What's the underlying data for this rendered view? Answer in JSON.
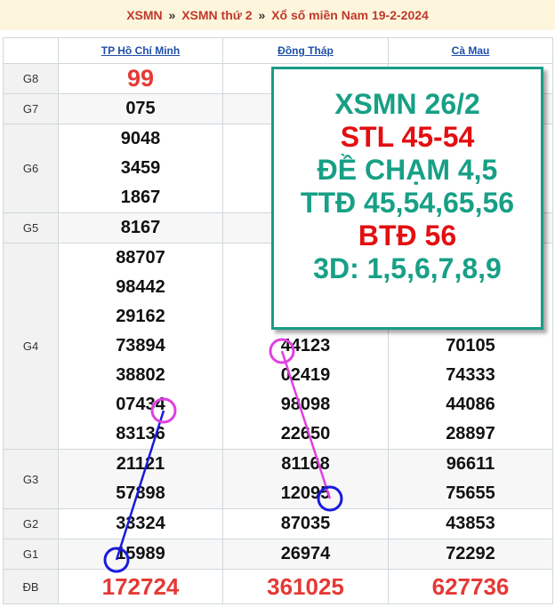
{
  "breadcrumb": {
    "item1": "XSMN",
    "sep": "»",
    "item2": "XSMN thứ 2",
    "item3": "Xổ số miền Nam 19-2-2024"
  },
  "table": {
    "columns": [
      "TP Hồ Chí Minh",
      "Đồng Tháp",
      "Cà Mau"
    ],
    "rows": [
      {
        "prize": "G8",
        "values": [
          [
            "99"
          ],
          [
            ""
          ],
          [
            ""
          ]
        ]
      },
      {
        "prize": "G7",
        "values": [
          [
            "075"
          ],
          [
            ""
          ],
          [
            ""
          ]
        ]
      },
      {
        "prize": "G6",
        "values": [
          [
            "9048",
            "3459",
            "1867"
          ],
          [
            "",
            "",
            ""
          ],
          [
            "",
            "",
            ""
          ]
        ]
      },
      {
        "prize": "G5",
        "values": [
          [
            "8167"
          ],
          [
            ""
          ],
          [
            ""
          ]
        ]
      },
      {
        "prize": "G4",
        "values": [
          [
            "88707",
            "98442",
            "29162",
            "73894",
            "38802",
            "07434",
            "83136"
          ],
          [
            "",
            "",
            "",
            "44123",
            "02419",
            "98098",
            "22650"
          ],
          [
            "",
            "",
            "",
            "70105",
            "74333",
            "44086",
            "28897"
          ]
        ]
      },
      {
        "prize": "G3",
        "values": [
          [
            "21121",
            "57898"
          ],
          [
            "81168",
            "12095"
          ],
          [
            "96611",
            "75655"
          ]
        ]
      },
      {
        "prize": "G2",
        "values": [
          [
            "33324"
          ],
          [
            "87035"
          ],
          [
            "43853"
          ]
        ]
      },
      {
        "prize": "G1",
        "values": [
          [
            "15989"
          ],
          [
            "26974"
          ],
          [
            "72292"
          ]
        ]
      },
      {
        "prize": "ĐB",
        "values": [
          [
            "172724"
          ],
          [
            "361025"
          ],
          [
            "627736"
          ]
        ]
      }
    ]
  },
  "promo": {
    "line1": "XSMN 26/2",
    "line2": "STL 45-54",
    "line3": "ĐỀ CHẠM 4,5",
    "line4": "TTĐ 45,54,65,56",
    "line5": "BTĐ 56",
    "line6": "3D: 1,5,6,7,8,9"
  },
  "colors": {
    "accent_teal": "#17a086",
    "accent_red": "#e30f10",
    "link_blue": "#1f4fa8",
    "marker_magenta": "#e040e0",
    "marker_blue": "#1a1adc"
  }
}
